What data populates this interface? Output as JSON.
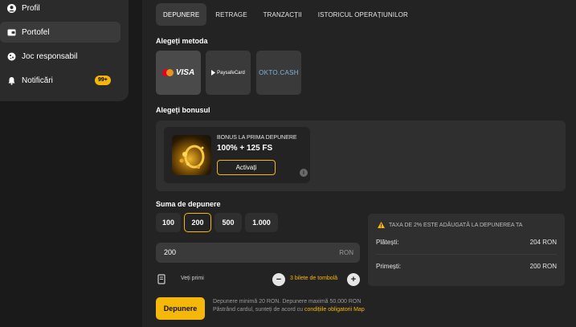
{
  "sidebar": {
    "items": [
      {
        "label": "Profil",
        "icon": "user-icon"
      },
      {
        "label": "Portofel",
        "icon": "wallet-icon"
      },
      {
        "label": "Joc responsabil",
        "icon": "cookie-icon"
      },
      {
        "label": "Notificări",
        "icon": "bell-icon",
        "badge": "99+"
      }
    ]
  },
  "tabs": [
    "DEPUNERE",
    "RETRAGE",
    "TRANZACȚII",
    "ISTORICUL OPERAȚIUNILOR"
  ],
  "methods": {
    "title": "Alegeți metoda",
    "items": [
      {
        "label": "VISA",
        "icon": "visa-mastercard-logo",
        "selected": true
      },
      {
        "label": "PaysafeCard",
        "icon": "paysafecard-logo",
        "selected": false
      },
      {
        "label": "OKTO.CASH",
        "icon": "okto-cash-logo",
        "selected": false
      }
    ]
  },
  "bonus": {
    "title": "Alegeți bonusul",
    "subtitle": "BONUS LA PRIMA DEPUNERE",
    "headline": "100% + 125 FS",
    "activate_label": "Activați",
    "info_symbol": "i"
  },
  "amount": {
    "title": "Suma de depunere",
    "presets": [
      "100",
      "200",
      "500",
      "1.000"
    ],
    "selected_preset": "200",
    "value": "200",
    "currency": "RON"
  },
  "receive": {
    "label": "Veți primi",
    "tickets": "3 bilete de tombolă",
    "minus": "−",
    "plus": "+"
  },
  "deposit": {
    "button_label": "Depunere",
    "terms_text": "Depunere minimă 20 RON. Depunere maximă 50.000 RON Păstrând cardul, sunteți de acord cu ",
    "terms_link": "condițiile obligatorii Map"
  },
  "summary": {
    "notice": "TAXA DE 2% ESTE ADĂUGATĂ LA DEPUNEREA TA",
    "pay_label": "Plătești:",
    "pay_value": "204 RON",
    "receive_label": "Primești:",
    "receive_value": "200 RON"
  },
  "colors": {
    "accent": "#f5b70a",
    "background": "#232323",
    "panel": "#2f2f2f"
  }
}
